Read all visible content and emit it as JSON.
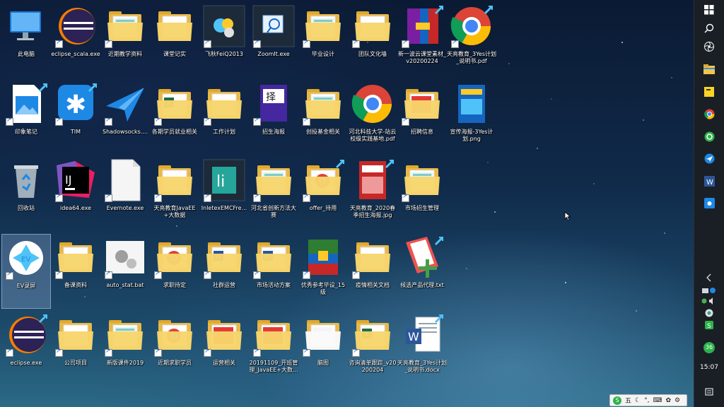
{
  "desktop": {
    "icons": [
      {
        "label": "此电脑",
        "type": "pc",
        "shortcut": false
      },
      {
        "label": "eclipse_scala.exe",
        "type": "eclipse",
        "shortcut": true
      },
      {
        "label": "近期教学资料",
        "type": "folder-doc",
        "shortcut": true
      },
      {
        "label": "课堂记实",
        "type": "folder",
        "shortcut": false
      },
      {
        "label": "飞秋FeiQ2013",
        "type": "feiq",
        "shortcut": true
      },
      {
        "label": "ZoomIt.exe",
        "type": "zoomit",
        "shortcut": true
      },
      {
        "label": "毕业设计",
        "type": "folder-doc",
        "shortcut": true
      },
      {
        "label": "团队文化墙",
        "type": "folder",
        "shortcut": true
      },
      {
        "label": "新一波云课堂素材_v20200224",
        "type": "rar",
        "shortcut": true
      },
      {
        "label": "天亮教育_3Yes计划_说明书.pdf",
        "type": "chrome",
        "shortcut": true
      },
      {
        "label": "印象笔记",
        "type": "image",
        "shortcut": true
      },
      {
        "label": "TIM",
        "type": "tim",
        "shortcut": true
      },
      {
        "label": "Shadowsocks....",
        "type": "shadowsocks",
        "shortcut": true
      },
      {
        "label": "各期学员就业相关",
        "type": "folder-excel",
        "shortcut": true
      },
      {
        "label": "工作计划",
        "type": "folder",
        "shortcut": true
      },
      {
        "label": "招生海报",
        "type": "poster",
        "shortcut": true
      },
      {
        "label": "创投基金相关",
        "type": "folder-doc",
        "shortcut": true
      },
      {
        "label": "河北科技大学-站云校级实践基地.pdf",
        "type": "chrome",
        "shortcut": false
      },
      {
        "label": "招聘信息",
        "type": "folder-red",
        "shortcut": true
      },
      {
        "label": "宣传海报-3Yes计划.png",
        "type": "poster2",
        "shortcut": false
      },
      {
        "label": "回收站",
        "type": "recycle",
        "shortcut": false
      },
      {
        "label": "idea64.exe",
        "type": "idea",
        "shortcut": true
      },
      {
        "label": "Evernote.exe",
        "type": "blank",
        "shortcut": true
      },
      {
        "label": "天亮教育JavaEE+大数据",
        "type": "folder",
        "shortcut": true
      },
      {
        "label": "InletexEMCFre...",
        "type": "inletex",
        "shortcut": true
      },
      {
        "label": "河北省创新方法大赛",
        "type": "folder-doc",
        "shortcut": true
      },
      {
        "label": "offer_待用",
        "type": "folder-chrome",
        "shortcut": true
      },
      {
        "label": "天亮教育_2020春季招生海报.jpg",
        "type": "poster3",
        "shortcut": false
      },
      {
        "label": "市场招生管理",
        "type": "folder-doc",
        "shortcut": true
      },
      {
        "label": "EV录屏",
        "type": "ev",
        "shortcut": true
      },
      {
        "label": "备课资料",
        "type": "folder",
        "shortcut": true
      },
      {
        "label": "auto_stat.bat",
        "type": "bat",
        "shortcut": true
      },
      {
        "label": "求职待定",
        "type": "folder-chrome",
        "shortcut": true
      },
      {
        "label": "社群运营",
        "type": "folder-word",
        "shortcut": true
      },
      {
        "label": "市场活动方案",
        "type": "folder-word",
        "shortcut": true
      },
      {
        "label": "优秀参考毕设_15级",
        "type": "rar2",
        "shortcut": true
      },
      {
        "label": "疫情相关文档",
        "type": "folder",
        "shortcut": true
      },
      {
        "label": "候选产品代理.txt",
        "type": "txt",
        "shortcut": false
      },
      {
        "label": "eclipse.exe",
        "type": "eclipse",
        "shortcut": true
      },
      {
        "label": "公司项目",
        "type": "folder",
        "shortcut": true
      },
      {
        "label": "新版课件2019",
        "type": "folder-doc",
        "shortcut": true
      },
      {
        "label": "近期求职学员",
        "type": "folder-chrome",
        "shortcut": true
      },
      {
        "label": "运营相关",
        "type": "folder-red",
        "shortcut": true
      },
      {
        "label": "20191109_开班管理_JavaEE+大数...",
        "type": "folder-red",
        "shortcut": true
      },
      {
        "label": "脑图",
        "type": "folder-white",
        "shortcut": true
      },
      {
        "label": "咨询清单跟踪_v20200204",
        "type": "folder-excel",
        "shortcut": true
      },
      {
        "label": "天亮教育_3Yes计划_说明书.docx",
        "type": "word",
        "shortcut": false
      }
    ]
  },
  "taskbar": {
    "clock": "15:07",
    "items": [
      "windows-icon",
      "search-icon",
      "task-view-icon",
      "file-explorer-icon",
      "sticky-notes-icon",
      "chrome-icon",
      "wechat-icon",
      "shadowsocks-icon",
      "word-icon",
      "media-icon"
    ],
    "tray": [
      "chevron-left-icon",
      "network-icon",
      "volume-icon",
      "app-tray-icon",
      "app-tray-icon-2"
    ],
    "badge": "36"
  },
  "ime": {
    "label": "五"
  },
  "colors": {
    "taskbar": "#1a1f26",
    "folder": "#f7d56c",
    "accent": "#1e88e5"
  }
}
